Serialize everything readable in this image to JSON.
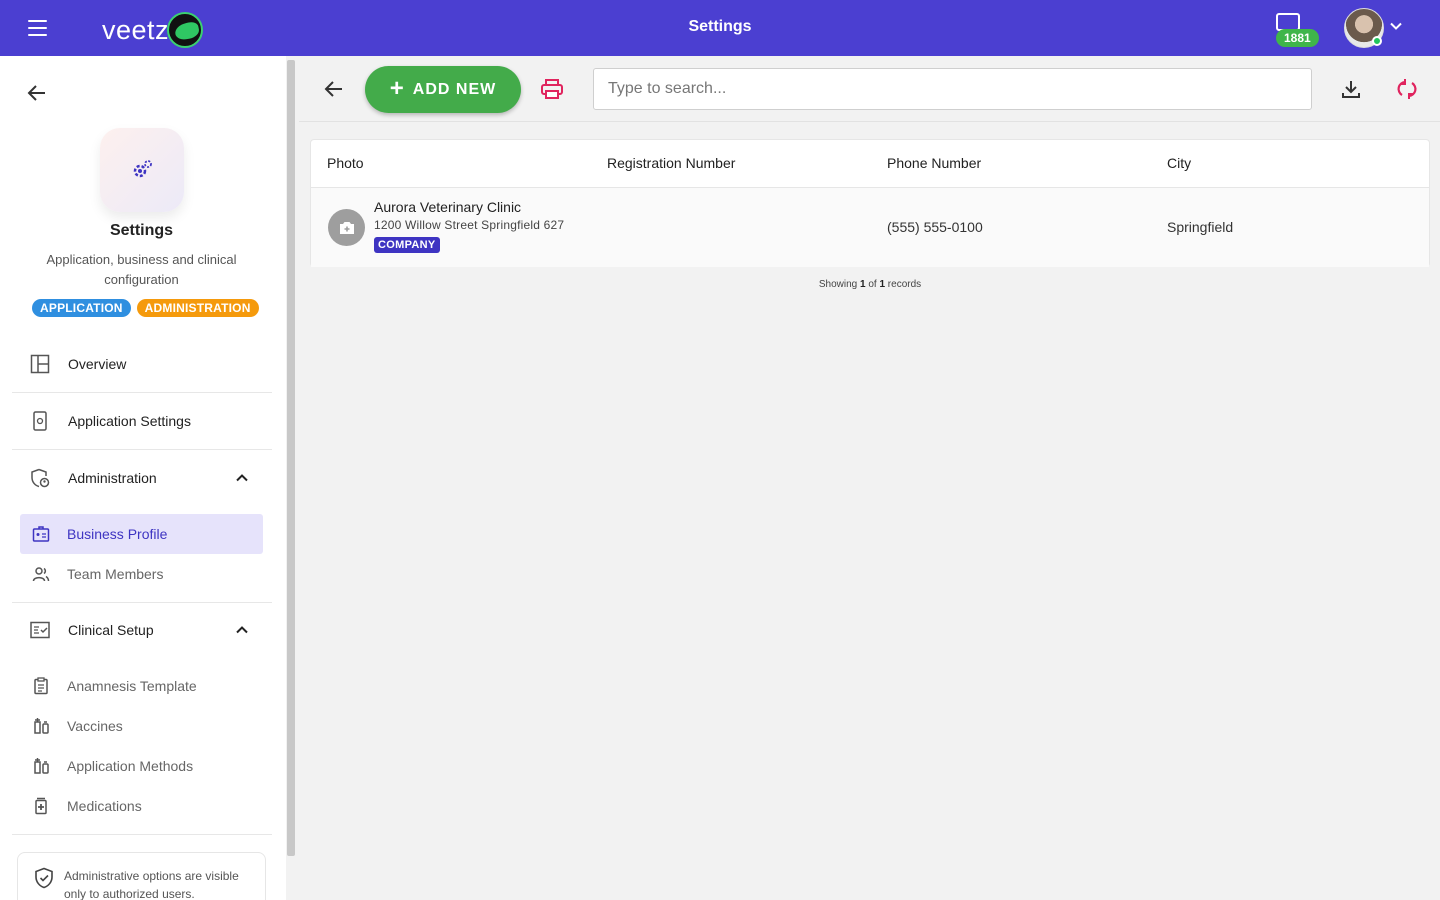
{
  "header": {
    "title": "Settings",
    "logo_text": "veetz",
    "notification_count": "1881"
  },
  "sidebar": {
    "title": "Settings",
    "description": "Application, business and clinical configuration",
    "tags": [
      "APPLICATION",
      "ADMINISTRATION"
    ],
    "nav": {
      "overview": "Overview",
      "application_settings": "Application Settings",
      "administration": "Administration",
      "clinical_setup": "Clinical Setup"
    },
    "admin_items": [
      "Business Profile",
      "Team Members"
    ],
    "clinical_items": [
      "Anamnesis Template",
      "Vaccines",
      "Application Methods",
      "Medications"
    ],
    "note": "Administrative options are visible only to authorized users."
  },
  "toolbar": {
    "add_new_label": "ADD NEW",
    "search_placeholder": "Type to search..."
  },
  "table": {
    "columns": [
      "Photo",
      "Registration Number",
      "Phone Number",
      "City"
    ],
    "rows": [
      {
        "name": "Aurora Veterinary Clinic",
        "address": "1200 Willow Street Springfield 627",
        "type": "COMPANY",
        "registration_number": "",
        "phone": "(555) 555-0100",
        "city": "Springfield"
      }
    ]
  },
  "footer": {
    "prefix": "Showing",
    "shown": "1",
    "of_label": "of",
    "total": "1",
    "suffix": "records"
  },
  "colors": {
    "header_bg": "#4b3fd1",
    "add_button": "#43ab4a",
    "accent_red": "#e0245e",
    "tag_application": "#2f8fe0",
    "tag_administration": "#f59a0c",
    "active_item_bg": "#e6e3fb"
  }
}
